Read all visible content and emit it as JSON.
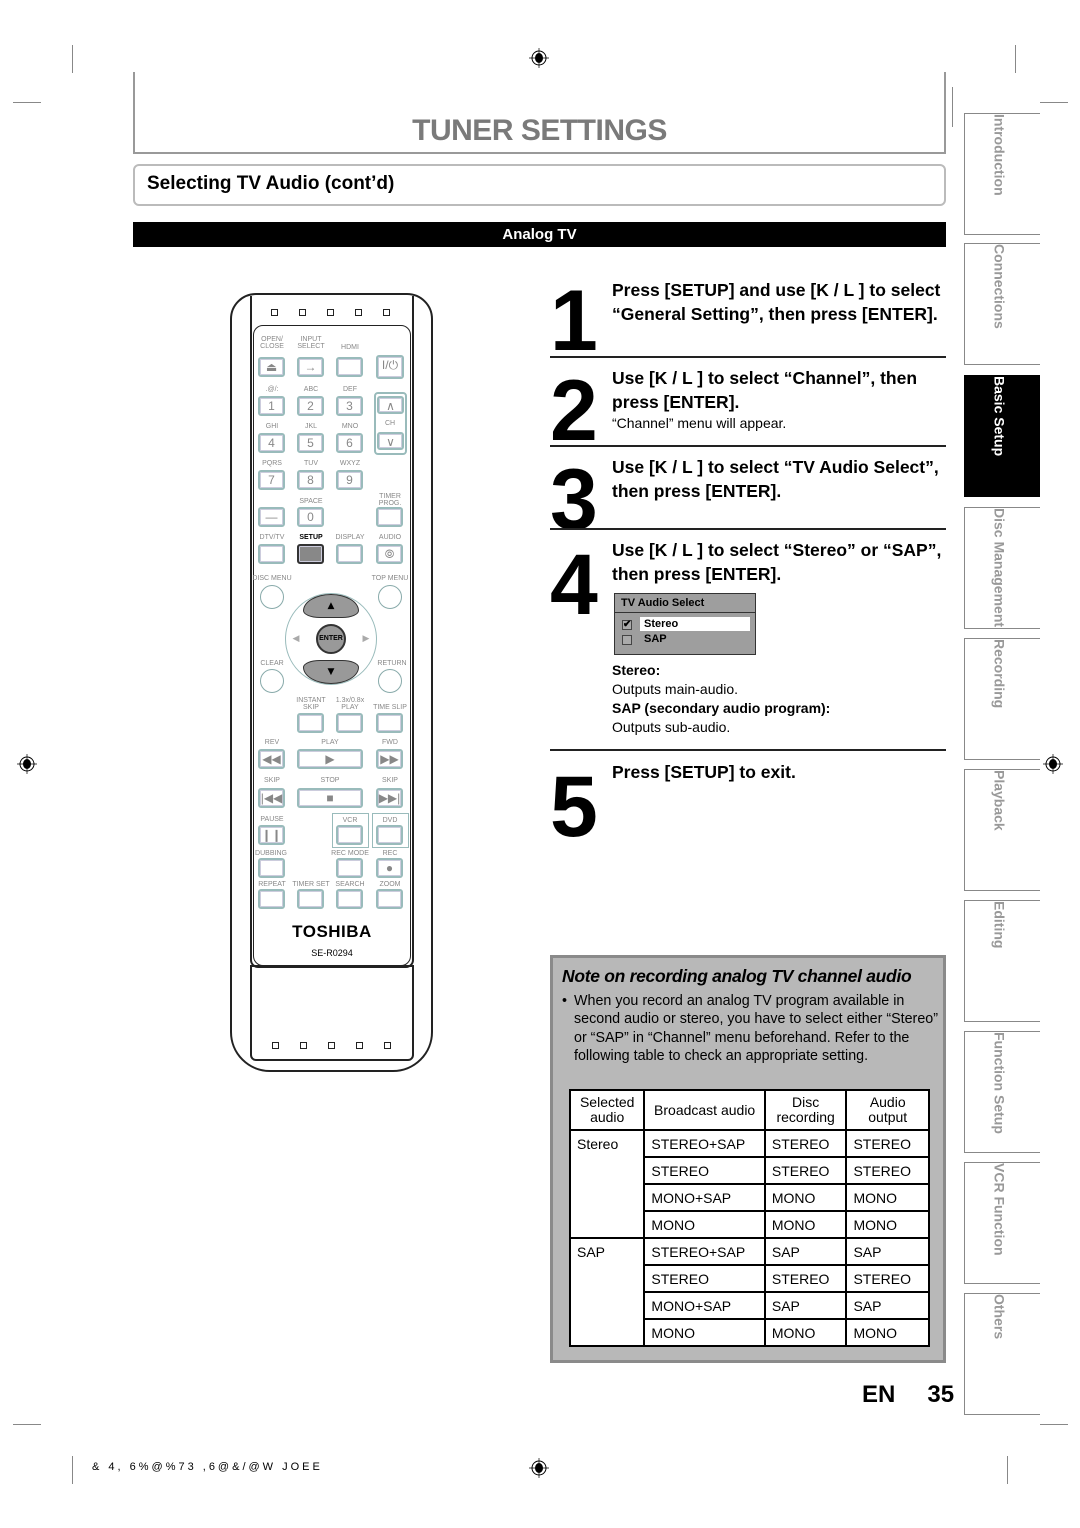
{
  "header": {
    "title": "TUNER SETTINGS",
    "section": "Selecting TV Audio (cont’d)",
    "subsection": "Analog TV"
  },
  "steps": [
    {
      "number": "1",
      "heading": "Press [SETUP] and use [K / L ] to select “General Setting”, then press [ENTER].",
      "note": ""
    },
    {
      "number": "2",
      "heading": "Use [K / L ] to select “Channel”, then press [ENTER].",
      "note": "“Channel” menu will appear."
    },
    {
      "number": "3",
      "heading": "Use [K / L ] to select “TV Audio Select”, then press [ENTER].",
      "note": ""
    },
    {
      "number": "4",
      "heading": "Use [K / L ] to select “Stereo” or “SAP”, then press [ENTER].",
      "note": ""
    },
    {
      "number": "5",
      "heading": "Press [SETUP] to exit.",
      "note": ""
    }
  ],
  "osd_menu": {
    "title": "TV Audio Select",
    "options": [
      {
        "label": "Stereo",
        "checked": true,
        "selected": true
      },
      {
        "label": "SAP",
        "checked": false,
        "selected": false
      }
    ]
  },
  "definitions": [
    {
      "term": "Stereo:",
      "desc": "Outputs main-audio."
    },
    {
      "term": "SAP (secondary audio program):",
      "desc": "Outputs sub-audio."
    }
  ],
  "note": {
    "title": "Note on recording analog TV channel audio",
    "bullet": "•",
    "text": "When you record an analog TV program available in second audio or stereo, you have to select either “Stereo” or “SAP” in “Channel” menu beforehand. Refer to the following table to check an appropriate setting.",
    "table": {
      "headers": [
        "Selected audio",
        "Broadcast audio",
        "Disc recording",
        "Audio output"
      ],
      "groups": [
        {
          "selected": "Stereo",
          "rows": [
            [
              "STEREO+SAP",
              "STEREO",
              "STEREO"
            ],
            [
              "STEREO",
              "STEREO",
              "STEREO"
            ],
            [
              "MONO+SAP",
              "MONO",
              "MONO"
            ],
            [
              "MONO",
              "MONO",
              "MONO"
            ]
          ]
        },
        {
          "selected": "SAP",
          "rows": [
            [
              "STEREO+SAP",
              "SAP",
              "SAP"
            ],
            [
              "STEREO",
              "STEREO",
              "STEREO"
            ],
            [
              "MONO+SAP",
              "SAP",
              "SAP"
            ],
            [
              "MONO",
              "MONO",
              "MONO"
            ]
          ]
        }
      ]
    }
  },
  "side_tabs": [
    {
      "label": "Introduction",
      "active": false
    },
    {
      "label": "Connections",
      "active": false
    },
    {
      "label": "Basic Setup",
      "active": true
    },
    {
      "label": "Disc Management",
      "active": false
    },
    {
      "label": "Recording",
      "active": false
    },
    {
      "label": "Playback",
      "active": false
    },
    {
      "label": "Editing",
      "active": false
    },
    {
      "label": "Function Setup",
      "active": false
    },
    {
      "label": "VCR Function",
      "active": false
    },
    {
      "label": "Others",
      "active": false
    }
  ],
  "footer": {
    "lang": "EN",
    "page": "35",
    "code": "& 4, 6%@%73   ,6@&/@W    JOEE"
  },
  "remote": {
    "brand": "TOSHIBA",
    "model": "SE-R0294",
    "labels": {
      "open_close": "OPEN/\nCLOSE",
      "input_select": "INPUT\nSELECT",
      "hdmi": "HDMI",
      "k1": ".@/:",
      "k2": "ABC",
      "k3": "DEF",
      "k4": "GHI",
      "k5": "JKL",
      "k6": "MNO",
      "k7": "PQRS",
      "k8": "TUV",
      "k9": "WXYZ",
      "ch": "CH",
      "space": "SPACE",
      "timer_prog": "TIMER\nPROG.",
      "dtv_tv": "DTV/TV",
      "setup": "SETUP",
      "display": "DISPLAY",
      "audio": "AUDIO",
      "disc_menu": "DISC MENU",
      "top_menu": "TOP MENU",
      "enter": "ENTER",
      "clear": "CLEAR",
      "return": "RETURN",
      "instant_skip": "INSTANT\nSKIP",
      "play_speed": "1.3x/0.8x\nPLAY",
      "time_slip": "TIME SLIP",
      "rev": "REV",
      "play": "PLAY",
      "fwd": "FWD",
      "skip_back": "SKIP",
      "stop": "STOP",
      "skip_fwd": "SKIP",
      "pause": "PAUSE",
      "vcr": "VCR",
      "dvd": "DVD",
      "dubbing": "DUBBING",
      "rec_mode": "REC MODE",
      "rec": "REC",
      "repeat": "REPEAT",
      "timer_set": "TIMER SET",
      "search": "SEARCH",
      "zoom": "ZOOM"
    },
    "digits": [
      "1",
      "2",
      "3",
      "4",
      "5",
      "6",
      "7",
      "8",
      "9",
      "0",
      "—"
    ],
    "power_glyph": "I/⏻",
    "glyphs": {
      "eject": "⏏",
      "input": "→",
      "rev": "◀◀",
      "play": "▶",
      "fwd": "▶▶",
      "prev": "|◀◀",
      "stop": "■",
      "next": "▶▶|",
      "pause": "❙❙",
      "rec": "●",
      "up": "▲",
      "down": "▼",
      "left": "◀",
      "right": "▶",
      "ch_up": "∧",
      "ch_down": "∨",
      "audio": "⦾"
    }
  }
}
